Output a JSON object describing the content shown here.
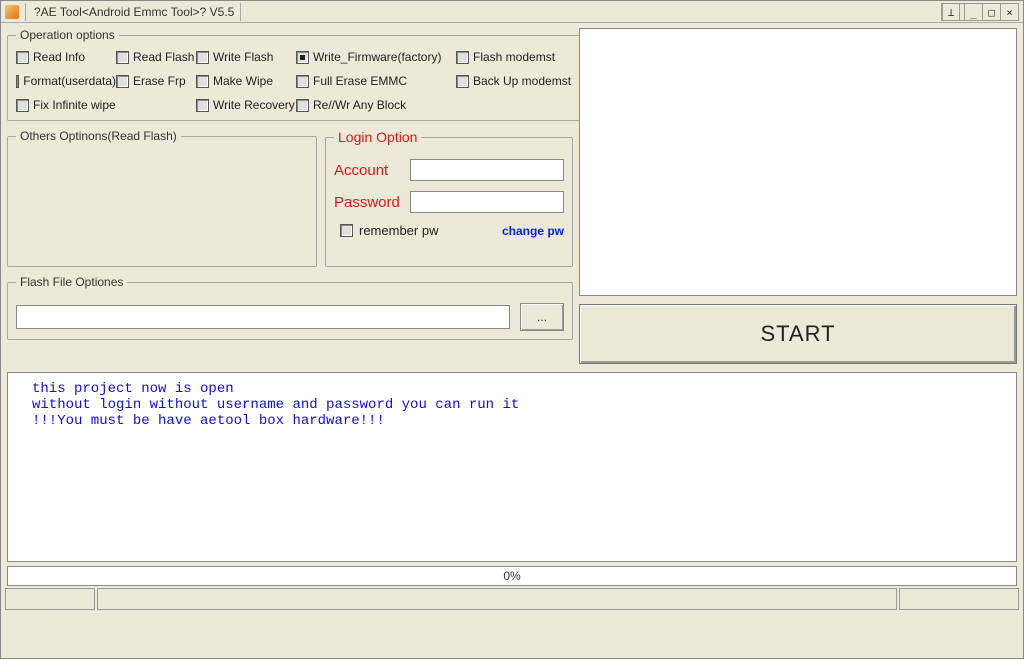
{
  "window": {
    "title": "?AE Tool<Android Emmc Tool>? V5.5"
  },
  "operation": {
    "legend": "Operation options",
    "items": {
      "read_info": "Read Info",
      "read_flash": "Read Flash",
      "write_flash": "Write Flash",
      "write_firmware": "Write_Firmware(factory)",
      "flash_modemst": "Flash modemst",
      "format_userdata": "Format(userdata)",
      "erase_frp": "Erase Frp",
      "make_wipe": "Make Wipe",
      "full_erase_emmc": "Full Erase EMMC",
      "backup_modemst": "Back Up modemst",
      "fix_infinite_wipe": "Fix Infinite wipe",
      "write_recovery": "Write Recovery",
      "rewr_any_block": "Re//Wr Any Block"
    },
    "selected": "write_firmware"
  },
  "others": {
    "legend": "Others Optinons(Read Flash)"
  },
  "login": {
    "legend": "Login Option",
    "account_label": "Account",
    "account_value": "",
    "password_label": "Password",
    "password_value": "",
    "remember_label": "remember pw",
    "change_pw_label": "change pw"
  },
  "flash": {
    "legend": "Flash File Optiones",
    "path_value": "",
    "browse_label": "..."
  },
  "start_label": "START",
  "log": {
    "line1": "this project now is open",
    "line2": "without login without username and password you can run it",
    "line3": "!!!You must be have aetool box hardware!!!"
  },
  "progress": {
    "text": "0%",
    "value": 0
  }
}
